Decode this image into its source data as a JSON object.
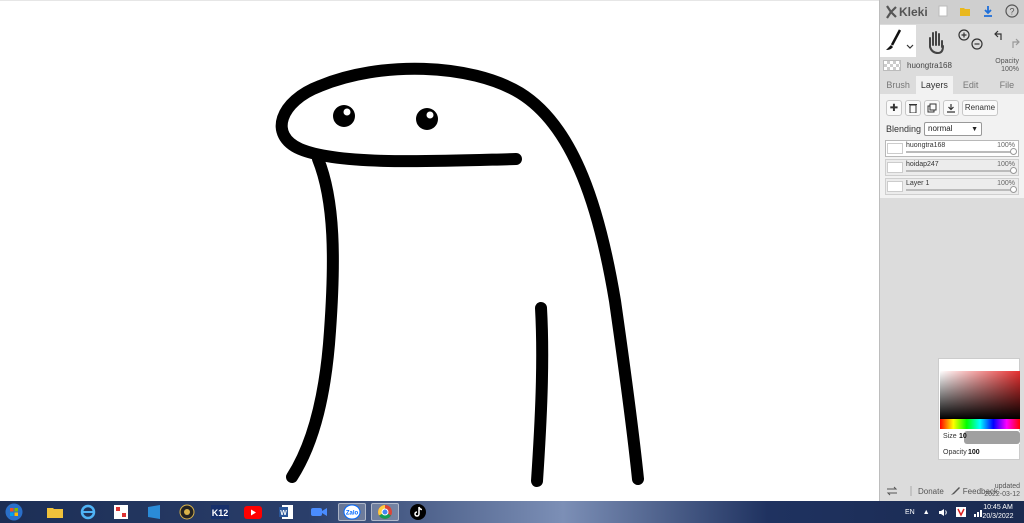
{
  "app": {
    "name": "Kleki"
  },
  "layer_header": {
    "name": "huongtra168",
    "opacity_label": "Opacity",
    "opacity_value": "100%"
  },
  "tabs": [
    {
      "label": "Brush",
      "active": false
    },
    {
      "label": "Layers",
      "active": true
    },
    {
      "label": "Edit",
      "active": false
    },
    {
      "label": "File",
      "active": false
    }
  ],
  "layer_actions": {
    "rename_label": "Rename"
  },
  "blending": {
    "label": "Blending",
    "value": "normal"
  },
  "layers": [
    {
      "name": "huongtra168",
      "opacity": "100%",
      "active": true
    },
    {
      "name": "hoidap247",
      "opacity": "100%",
      "active": false
    },
    {
      "name": "Layer 1",
      "opacity": "100%",
      "active": false
    }
  ],
  "color_picker": {
    "size_label": "Size",
    "size_value": "10",
    "opacity_label": "Opacity",
    "opacity_value": "100",
    "base_hue": "#e53030"
  },
  "footer": {
    "donate_label": "Donate",
    "feedback_label": "Feedback",
    "updated_label": "updated",
    "updated_date": "2022-03-12"
  },
  "taskbar": {
    "language": "EN",
    "time": "10:45 AM",
    "date": "20/3/2022",
    "apps": [
      "start-orb",
      "file-explorer",
      "internet-explorer",
      "ocr-app",
      "windows-store",
      "chess-app",
      "k12-app",
      "youtube",
      "word",
      "zoom",
      "zalo",
      "chrome",
      "tiktok"
    ]
  },
  "colors": {
    "panel": "#dcdcdc",
    "stroke": "#000000",
    "accent_blue": "#1e6fd9"
  }
}
